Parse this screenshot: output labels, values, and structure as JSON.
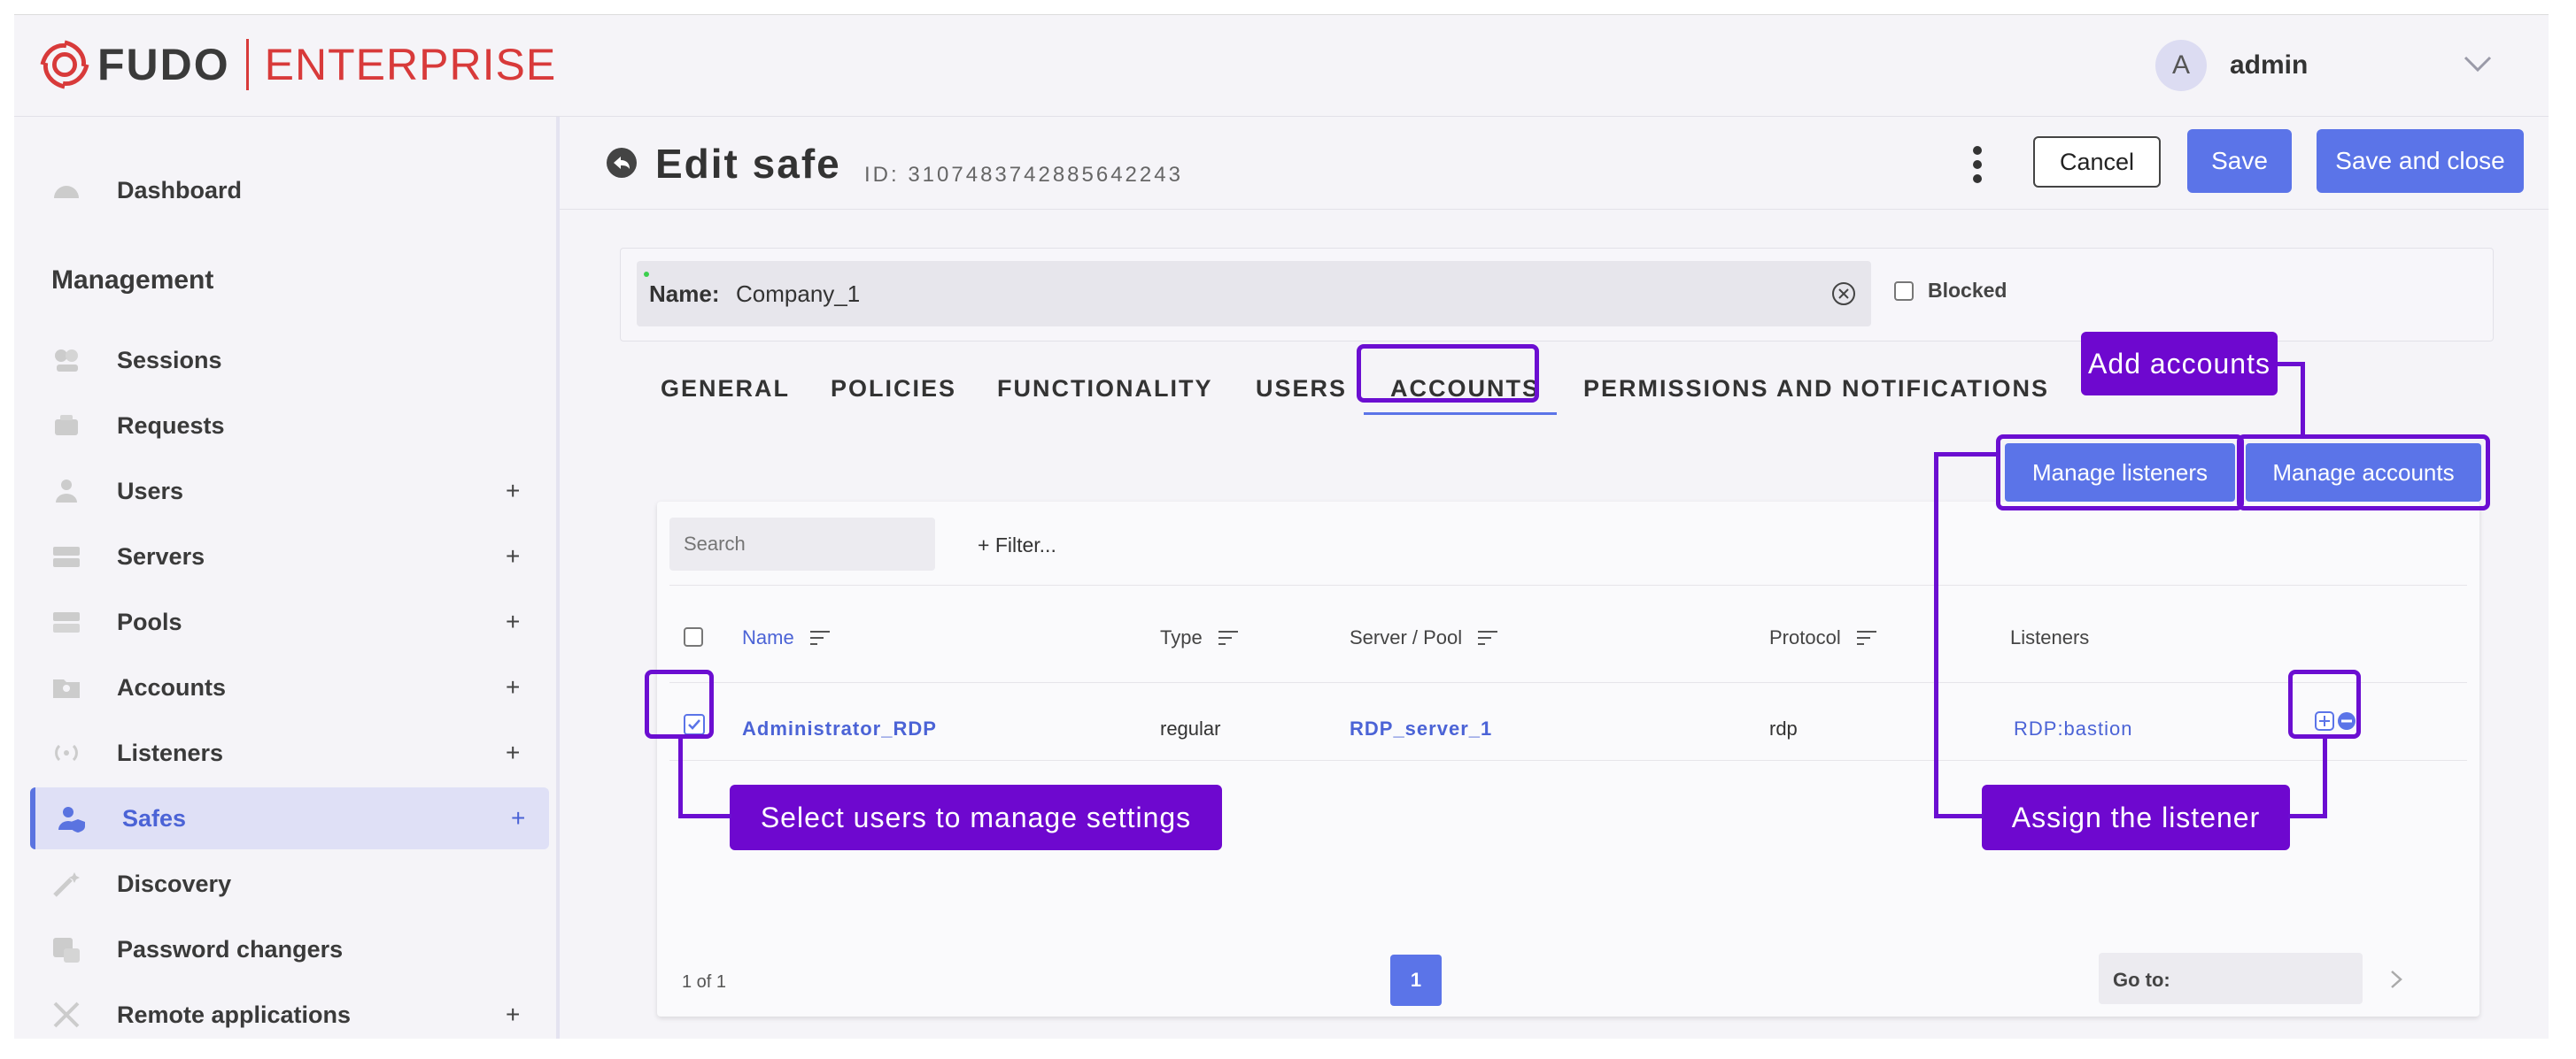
{
  "header": {
    "brand_primary": "FUDO",
    "brand_secondary": "ENTERPRISE",
    "user_initial": "A",
    "user_name": "admin"
  },
  "sidebar": {
    "dashboard": "Dashboard",
    "section_title": "Management",
    "items": [
      {
        "label": "Sessions",
        "icon": "sessions-icon",
        "expandable": false
      },
      {
        "label": "Requests",
        "icon": "requests-icon",
        "expandable": false
      },
      {
        "label": "Users",
        "icon": "users-icon",
        "expandable": true
      },
      {
        "label": "Servers",
        "icon": "servers-icon",
        "expandable": true
      },
      {
        "label": "Pools",
        "icon": "pools-icon",
        "expandable": true
      },
      {
        "label": "Accounts",
        "icon": "accounts-icon",
        "expandable": true
      },
      {
        "label": "Listeners",
        "icon": "listeners-icon",
        "expandable": true
      },
      {
        "label": "Safes",
        "icon": "safes-icon",
        "expandable": true,
        "active": true
      },
      {
        "label": "Discovery",
        "icon": "discovery-icon",
        "expandable": false
      },
      {
        "label": "Password changers",
        "icon": "password-changers-icon",
        "expandable": false
      },
      {
        "label": "Remote applications",
        "icon": "remote-applications-icon",
        "expandable": true
      }
    ],
    "plus": "+"
  },
  "page": {
    "title": "Edit safe",
    "id_text": "ID: 3107483742885642243",
    "cancel": "Cancel",
    "save": "Save",
    "save_close": "Save and close"
  },
  "form": {
    "name_label": "Name:",
    "name_value": "Company_1",
    "blocked_label": "Blocked"
  },
  "tabs": [
    "GENERAL",
    "POLICIES",
    "FUNCTIONALITY",
    "USERS",
    "ACCOUNTS",
    "PERMISSIONS AND NOTIFICATIONS"
  ],
  "actions": {
    "manage_listeners": "Manage listeners",
    "manage_accounts": "Manage accounts"
  },
  "table": {
    "search_placeholder": "Search",
    "filter": "+ Filter...",
    "columns": [
      "Name",
      "Type",
      "Server / Pool",
      "Protocol",
      "Listeners"
    ],
    "rows": [
      {
        "name": "Administrator_RDP",
        "type": "regular",
        "server": "RDP_server_1",
        "protocol": "rdp",
        "listener": "RDP:bastion",
        "checked": true
      }
    ],
    "pager_info": "1 of 1",
    "current_page": "1",
    "goto_label": "Go to:"
  },
  "annotations": {
    "add_accounts": "Add accounts",
    "select_users": "Select users to manage settings",
    "assign_listener": "Assign the listener"
  },
  "colors": {
    "accent": "#5b74e8",
    "annotation": "#6e08cf",
    "brand_red": "#d83a3a"
  }
}
